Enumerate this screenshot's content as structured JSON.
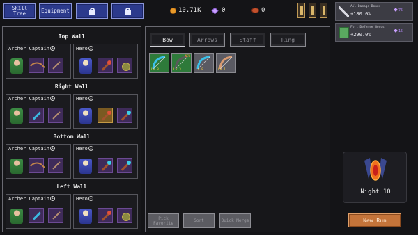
{
  "topbar": {
    "skill_tree": "Skill Tree",
    "equipment": "Equipment",
    "locked_1": "locked",
    "locked_2": "locked",
    "coins": "10.71K",
    "gems": "0",
    "meat": "0"
  },
  "walls": [
    {
      "title": "Top Wall",
      "left_label": "Archer Captain",
      "right_label": "Hero",
      "left_items": [
        "bow",
        "arrow"
      ],
      "right_items": [
        "staff",
        "orb"
      ]
    },
    {
      "title": "Right Wall",
      "left_label": "Archer Captain",
      "right_label": "Hero",
      "left_items": [
        "blue-bow",
        "arrow"
      ],
      "right_items": [
        "staff",
        "blue-staff"
      ]
    },
    {
      "title": "Bottom Wall",
      "left_label": "Archer Captain",
      "right_label": "Hero",
      "left_items": [
        "bow",
        "arrow"
      ],
      "right_items": [
        "blue-staff",
        "blue-staff"
      ]
    },
    {
      "title": "Left Wall",
      "left_label": "Archer Captain",
      "right_label": "Hero",
      "left_items": [
        "blue-bow",
        "arrow"
      ],
      "right_items": [
        "staff",
        "orb"
      ]
    }
  ],
  "tabs": [
    "Bow",
    "Arrows",
    "Staff",
    "Ring"
  ],
  "inventory": [
    {
      "name": "blue-bow",
      "level": "Lv.8",
      "new": ""
    },
    {
      "name": "dark-bow",
      "level": "Lv.3",
      "new": "NEW"
    },
    {
      "name": "blue-bow",
      "level": "Lv.8",
      "new": ""
    },
    {
      "name": "wood-bow",
      "level": "Lv.1",
      "new": ""
    }
  ],
  "bottom_buttons": {
    "equip": "Pick Favorite",
    "sort": "Sort",
    "merge": "Quick Merge"
  },
  "bonuses": [
    {
      "title": "All Damage Bonus",
      "value": "+180.0%",
      "cost": "75"
    },
    {
      "title": "Fort Defense Bonus",
      "value": "+290.0%",
      "cost": "15"
    }
  ],
  "night": "Night 10",
  "new_run": "New Run",
  "colors": {
    "accent_blue": "#2c3a8c",
    "item_purple": "#3f2b5a",
    "new_run_orange": "#c4743a",
    "level_yellow": "#ffd43a"
  }
}
